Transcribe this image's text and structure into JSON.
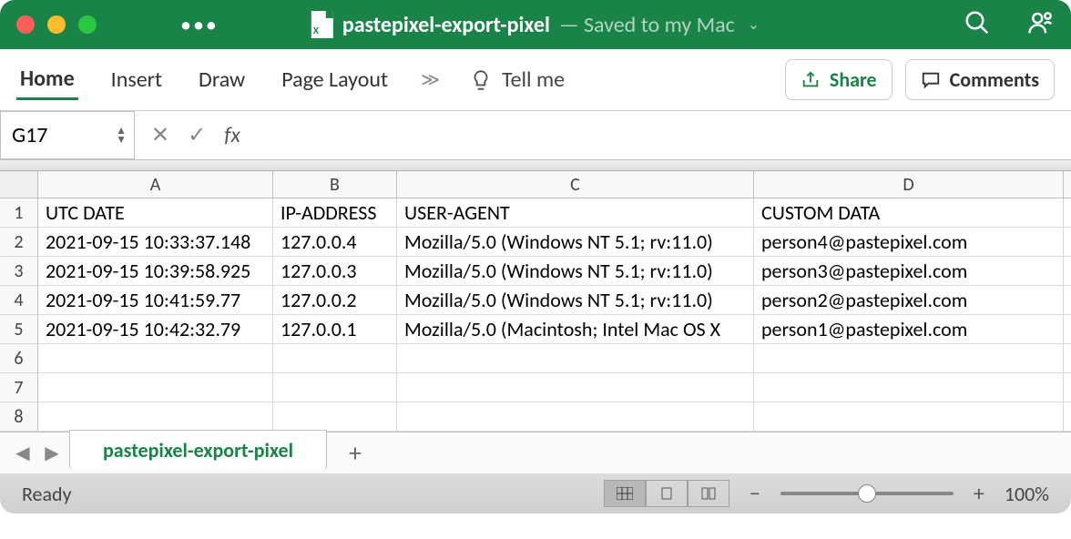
{
  "titlebar": {
    "filename": "pastepixel-export-pixel",
    "saved_status": "— Saved to my Mac"
  },
  "ribbon": {
    "tabs": [
      "Home",
      "Insert",
      "Draw",
      "Page Layout"
    ],
    "tell_me": "Tell me",
    "share": "Share",
    "comments": "Comments"
  },
  "namebox": {
    "ref": "G17"
  },
  "columns": [
    "A",
    "B",
    "C",
    "D"
  ],
  "headers": {
    "A": "UTC DATE",
    "B": "IP-ADDRESS",
    "C": "USER-AGENT",
    "D": "CUSTOM DATA"
  },
  "rows": [
    {
      "n": "1"
    },
    {
      "n": "2",
      "A": "2021-09-15 10:33:37.148",
      "B": "127.0.0.4",
      "C": "Mozilla/5.0 (Windows NT 5.1; rv:11.0) ",
      "D": "person4@pastepixel.com"
    },
    {
      "n": "3",
      "A": "2021-09-15 10:39:58.925",
      "B": "127.0.0.3",
      "C": "Mozilla/5.0 (Windows NT 5.1; rv:11.0) ",
      "D": "person3@pastepixel.com"
    },
    {
      "n": "4",
      "A": "2021-09-15 10:41:59.77",
      "B": "127.0.0.2",
      "C": "Mozilla/5.0 (Windows NT 5.1; rv:11.0) ",
      "D": "person2@pastepixel.com"
    },
    {
      "n": "5",
      "A": "2021-09-15 10:42:32.79",
      "B": "127.0.0.1",
      "C": "Mozilla/5.0 (Macintosh; Intel Mac OS X",
      "D": "person1@pastepixel.com"
    },
    {
      "n": "6"
    },
    {
      "n": "7"
    },
    {
      "n": "8"
    }
  ],
  "sheet_tab": "pastepixel-export-pixel",
  "status": {
    "ready": "Ready",
    "zoom": "100%"
  }
}
